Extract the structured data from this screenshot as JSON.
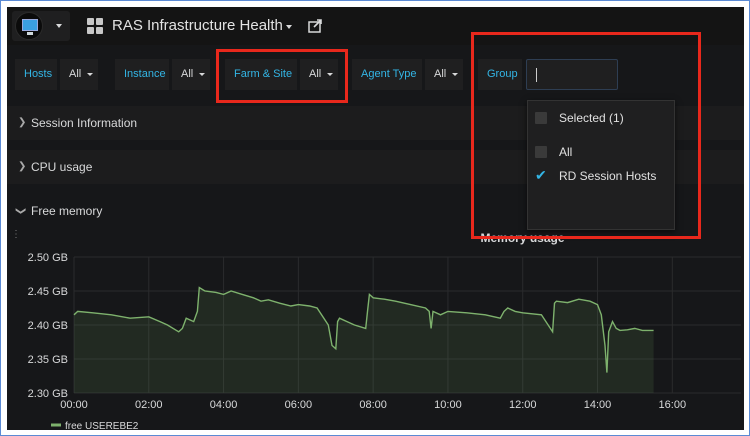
{
  "navbar": {
    "dashboard_title": "RAS Infrastructure Health",
    "icons": [
      "monitor-logo-icon",
      "dashboard-grid-icon",
      "share-icon",
      "chevron-down-icon"
    ]
  },
  "variables": [
    {
      "label": "Hosts",
      "value": "All"
    },
    {
      "label": "Instance",
      "value": "All"
    },
    {
      "label": "Farm & Site",
      "value": "All"
    },
    {
      "label": "Agent Type",
      "value": "All"
    },
    {
      "label": "Group",
      "value": ""
    }
  ],
  "rows": {
    "session": "Session Information",
    "cpu": "CPU usage",
    "memory": "Free memory"
  },
  "dropdown": {
    "selected_header": "Selected (1)",
    "options": [
      {
        "label": "All",
        "checked": false
      },
      {
        "label": "RD Session Hosts",
        "checked": true
      }
    ]
  },
  "colors": {
    "accent": "#33b5e5",
    "series": "#7eb26d",
    "highlight": "#e8281c",
    "background": "#161719"
  },
  "chart_data": {
    "type": "area",
    "title": "Memory usage",
    "x_tick_labels": [
      "00:00",
      "02:00",
      "04:00",
      "06:00",
      "08:00",
      "10:00",
      "12:00",
      "14:00",
      "16:00"
    ],
    "xlim": [
      0,
      16.5
    ],
    "ylim": [
      2.3,
      2.5
    ],
    "y_ticks": [
      2.3,
      2.35,
      2.4,
      2.45,
      2.5
    ],
    "y_tick_labels": [
      "2.30 GB",
      "2.35 GB",
      "2.40 GB",
      "2.45 GB",
      "2.50 GB"
    ],
    "legend_position": "bottom-left",
    "series": [
      {
        "name": "free USEREBE2",
        "x": [
          0,
          0.1,
          0.5,
          1.0,
          1.5,
          2.0,
          2.3,
          2.5,
          2.8,
          2.9,
          3.0,
          3.2,
          3.3,
          3.35,
          3.5,
          3.8,
          4.0,
          4.2,
          4.5,
          4.8,
          5.0,
          5.2,
          5.5,
          5.8,
          6.0,
          6.3,
          6.5,
          6.8,
          6.9,
          7.0,
          7.05,
          7.1,
          7.3,
          7.5,
          7.8,
          7.85,
          7.9,
          8.0,
          8.3,
          8.6,
          9.0,
          9.4,
          9.5,
          9.55,
          9.6,
          9.8,
          10.0,
          10.5,
          11.0,
          11.4,
          11.5,
          11.6,
          11.8,
          12.0,
          12.5,
          12.8,
          12.85,
          12.9,
          13.2,
          13.5,
          13.8,
          14.0,
          14.1,
          14.2,
          14.25,
          14.3,
          14.4,
          14.5,
          14.6,
          14.8,
          15.0,
          15.2,
          15.5
        ],
        "values": [
          2.415,
          2.42,
          2.418,
          2.415,
          2.41,
          2.412,
          2.405,
          2.4,
          2.39,
          2.395,
          2.41,
          2.405,
          2.42,
          2.455,
          2.45,
          2.448,
          2.445,
          2.45,
          2.445,
          2.44,
          2.435,
          2.437,
          2.432,
          2.428,
          2.43,
          2.428,
          2.425,
          2.4,
          2.37,
          2.365,
          2.405,
          2.41,
          2.405,
          2.4,
          2.395,
          2.42,
          2.445,
          2.44,
          2.438,
          2.435,
          2.43,
          2.425,
          2.42,
          2.395,
          2.42,
          2.415,
          2.42,
          2.418,
          2.415,
          2.41,
          2.42,
          2.425,
          2.42,
          2.418,
          2.415,
          2.39,
          2.432,
          2.435,
          2.433,
          2.438,
          2.435,
          2.43,
          2.415,
          2.37,
          2.33,
          2.39,
          2.405,
          2.395,
          2.392,
          2.393,
          2.395,
          2.392,
          2.392
        ]
      }
    ]
  }
}
